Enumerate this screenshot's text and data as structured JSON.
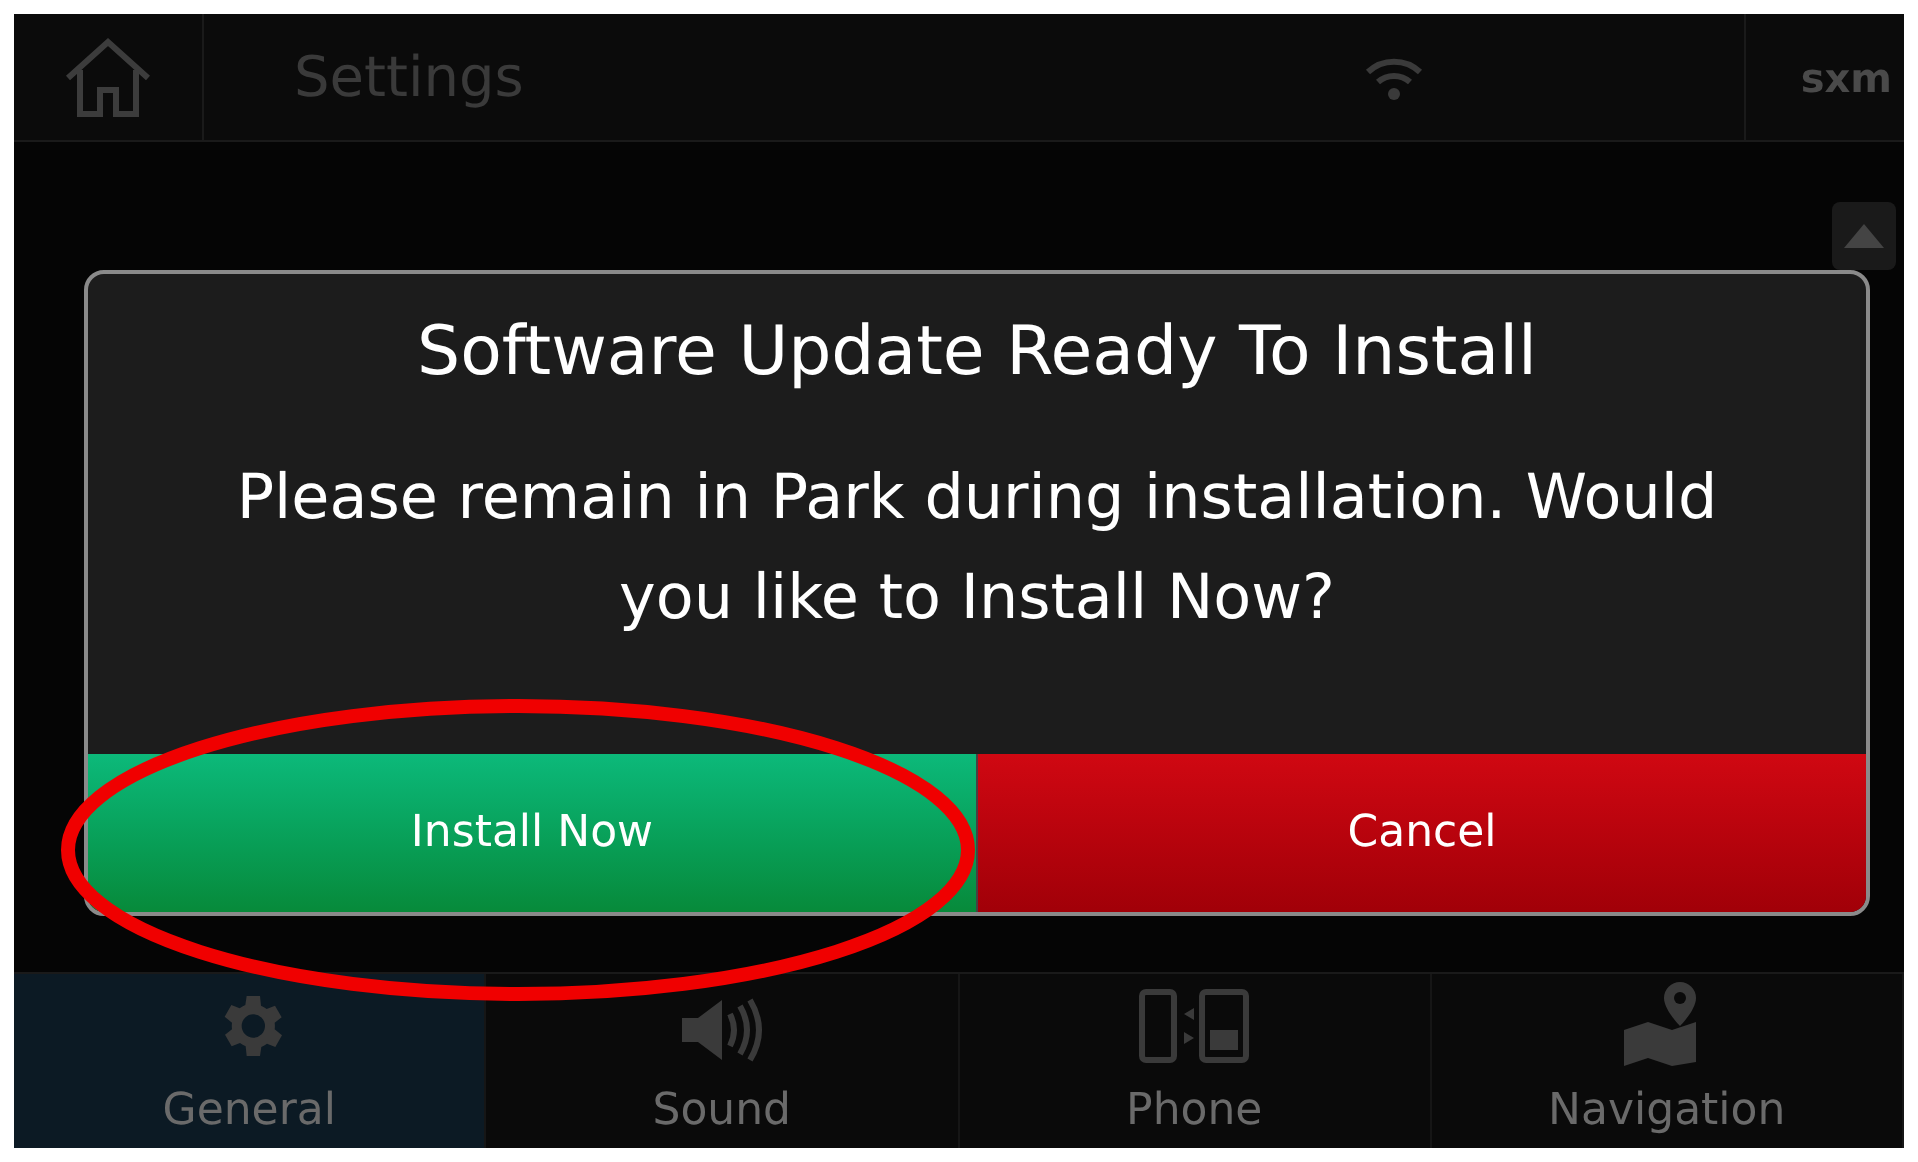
{
  "header": {
    "title": "Settings",
    "badge": "sxm"
  },
  "dialog": {
    "title": "Software Update Ready To Install",
    "message": "Please remain in Park during installation. Would you like to Install Now?",
    "buttons": [
      {
        "label": "Install Now",
        "kind": "confirm",
        "highlighted": true
      },
      {
        "label": "Cancel",
        "kind": "cancel",
        "highlighted": false
      }
    ]
  },
  "tabs": [
    {
      "label": "General",
      "kind": "gear",
      "selected": true
    },
    {
      "label": "Sound",
      "kind": "speaker",
      "selected": false
    },
    {
      "label": "Phone",
      "kind": "phone",
      "selected": false
    },
    {
      "label": "Navigation",
      "kind": "map",
      "selected": false
    }
  ]
}
